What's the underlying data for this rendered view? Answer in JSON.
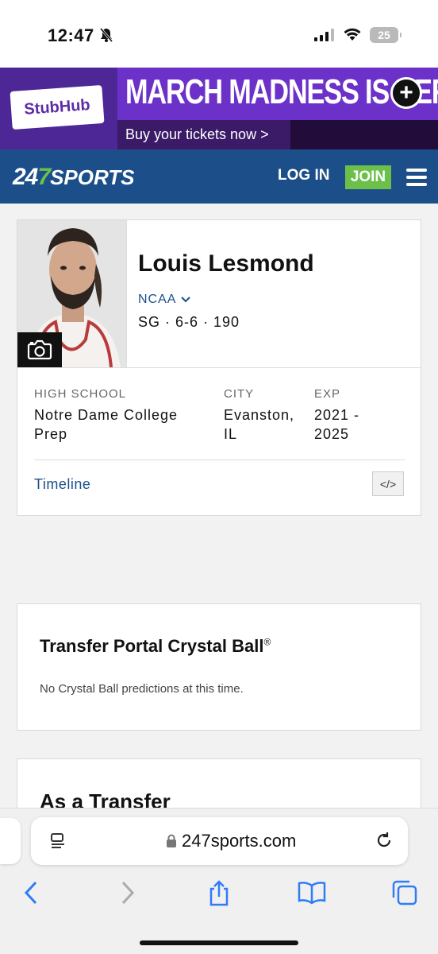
{
  "status_bar": {
    "time": "12:47",
    "battery": "25",
    "icons": [
      "bell-slash-icon",
      "signal-icon",
      "wifi-icon",
      "battery-icon"
    ]
  },
  "ad": {
    "brand": "StubHub",
    "headline": "MARCH MADNESS IS HERE",
    "cta": "Buy your tickets now >"
  },
  "nav": {
    "brand_a": "24",
    "brand_seven": "7",
    "brand_b": "SPORTS",
    "login": "LOG IN",
    "join": "JOIN"
  },
  "profile": {
    "name": "Louis Lesmond",
    "league": "NCAA",
    "measurements": "SG · 6-6 · 190",
    "high_school_label": "HIGH SCHOOL",
    "high_school_value": "Notre Dame College Prep",
    "city_label": "CITY",
    "city_value": "Evanston, IL",
    "exp_label": "EXP",
    "exp_value": "2021 - 2025",
    "timeline": "Timeline",
    "embed_label": "</>"
  },
  "crystal_ball": {
    "title": "Transfer Portal Crystal Ball",
    "reg": "®",
    "message": "No Crystal Ball predictions at this time."
  },
  "transfer": {
    "title": "As a Transfer"
  },
  "browser": {
    "url": "247sports.com"
  },
  "colors": {
    "nav": "#1c4f89",
    "join": "#6cc04a",
    "ad_purple": "#6c31c9",
    "link": "#1c4f89"
  }
}
